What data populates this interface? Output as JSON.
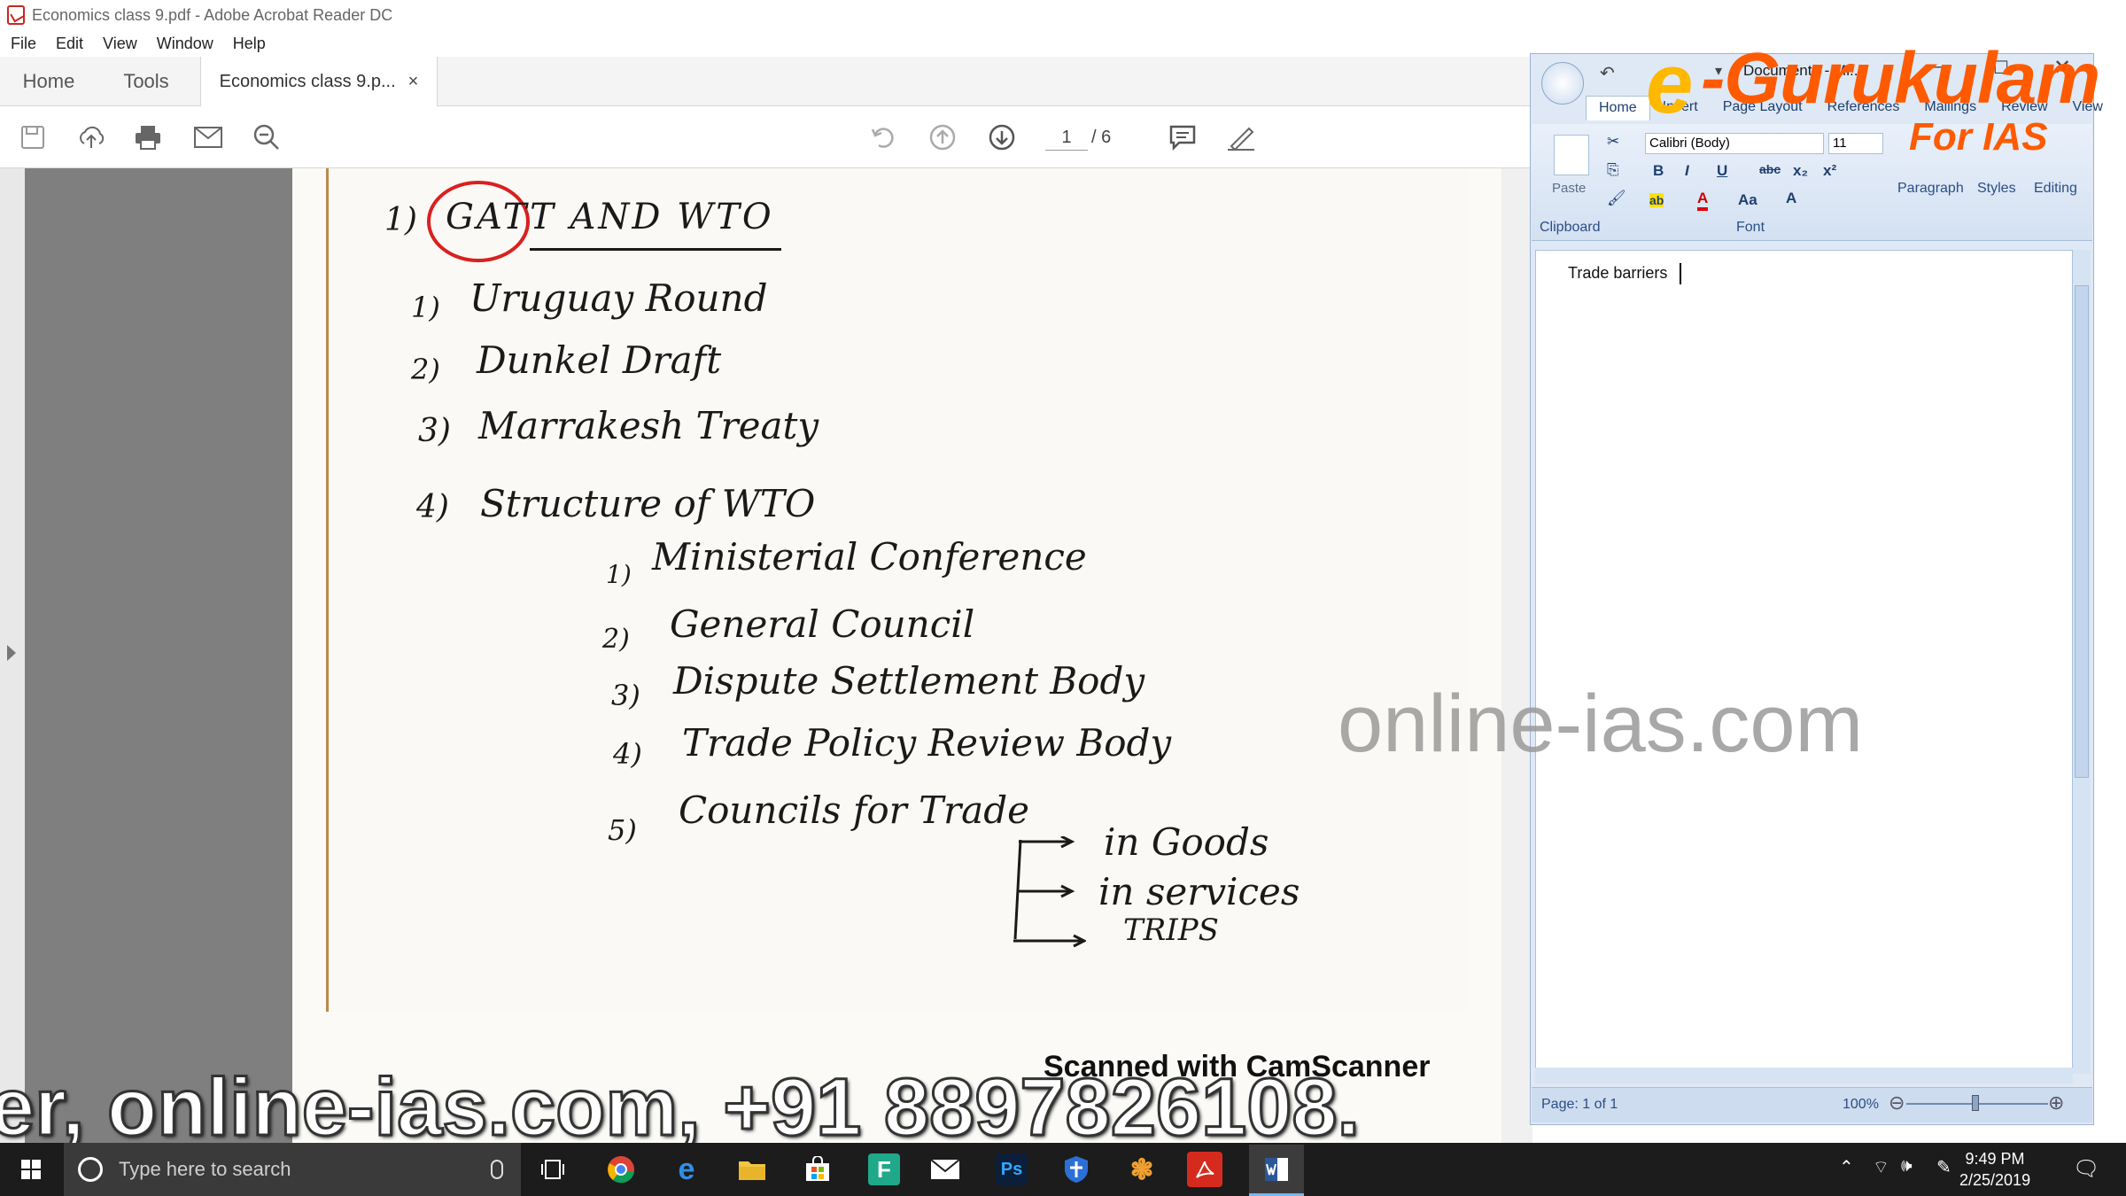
{
  "acrobat": {
    "window_title": "Economics class 9.pdf - Adobe Acrobat Reader DC",
    "menu": [
      "File",
      "Edit",
      "View",
      "Window",
      "Help"
    ],
    "tabs": {
      "home": "Home",
      "tools": "Tools",
      "document": "Economics class 9.p...",
      "close": "×"
    },
    "page_current": "1",
    "page_total": "/ 6",
    "toolbar_icons": [
      "save-icon",
      "upload-icon",
      "print-icon",
      "email-icon",
      "zoom-out-icon",
      "rotate-icon",
      "page-up-icon",
      "page-down-icon",
      "comment-icon",
      "pen-icon"
    ]
  },
  "pdf_notes": {
    "heading_number": "1)",
    "heading": "GATT AND WTO",
    "items": [
      {
        "num": "1)",
        "text": "Uruguay Round"
      },
      {
        "num": "2)",
        "text": "Dunkel Draft"
      },
      {
        "num": "3)",
        "text": "Marrakesh Treaty"
      },
      {
        "num": "4)",
        "text": "Structure of WTO"
      }
    ],
    "subitems": [
      {
        "num": "1)",
        "text": "Ministerial Conference"
      },
      {
        "num": "2)",
        "text": "General Council"
      },
      {
        "num": "3)",
        "text": "Dispute Settlement Body"
      },
      {
        "num": "4)",
        "text": "Trade Policy Review Body"
      },
      {
        "num": "5)",
        "text": "Councils for Trade"
      }
    ],
    "branches": [
      "in Goods",
      "in services",
      "TRIPS"
    ],
    "footer": "Scanned with CamScanner"
  },
  "word": {
    "title": "Document1 - Mi...",
    "tabs": [
      "Home",
      "Insert",
      "Page Layout",
      "References",
      "Mailings",
      "Review",
      "View"
    ],
    "font_name": "Calibri (Body)",
    "font_size": "11",
    "format_buttons": [
      "B",
      "I",
      "U",
      "abc",
      "x₂",
      "x²",
      "Aa",
      "A",
      "A"
    ],
    "groups": {
      "clipboard": "Clipboard",
      "paste": "Paste",
      "font": "Font",
      "paragraph": "Paragraph",
      "styles": "Styles",
      "editing": "Editing"
    },
    "body_text": "Trade barriers",
    "status_page": "Page: 1 of 1",
    "zoom": "100%"
  },
  "overlays": {
    "brand_e": "e",
    "brand": "-Gurukulam",
    "brand_sub": "For IAS",
    "watermark": "online-ias.com",
    "ticker": "er, online-ias.com, +91 8897826108."
  },
  "taskbar": {
    "search_placeholder": "Type here to search",
    "time": "9:49 PM",
    "date": "2/25/2019",
    "apps": [
      "chrome-icon",
      "edge-icon",
      "file-explorer-icon",
      "store-icon",
      "f-app-icon",
      "mail-icon",
      "photoshop-icon",
      "shield-app-icon",
      "snowflake-app-icon",
      "acrobat-icon",
      "word-icon"
    ],
    "app_labels": {
      "photoshop": "Ps",
      "f_app": "F"
    }
  },
  "colors": {
    "brand_orange": "#ff5a00",
    "annotation_red": "#d92020",
    "word_blue": "#2b4e84",
    "taskbar": "#1c1c1c"
  }
}
